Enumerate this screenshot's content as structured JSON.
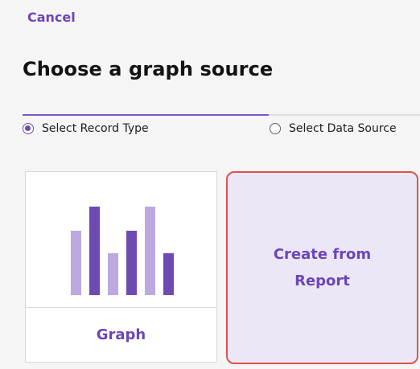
{
  "header": {
    "cancel_label": "Cancel",
    "title": "Choose a graph source"
  },
  "steps": [
    {
      "label": "Select Record Type",
      "selected": true
    },
    {
      "label": "Select Data Source",
      "selected": false
    }
  ],
  "cards": {
    "graph": {
      "label": "Graph",
      "icon": "bar-chart-icon",
      "icon_bars": [
        {
          "value": 80,
          "shade": "light"
        },
        {
          "value": 110,
          "shade": "dark"
        },
        {
          "value": 52,
          "shade": "light"
        },
        {
          "value": 80,
          "shade": "dark"
        },
        {
          "value": 110,
          "shade": "light"
        },
        {
          "value": 52,
          "shade": "dark"
        }
      ]
    },
    "report": {
      "label_line_1": "Create from",
      "label_line_2": "Report",
      "highlighted": true
    }
  },
  "colors": {
    "accent": "#6b46b8",
    "bar_dark": "#6d4bb2",
    "bar_light": "#bda8df",
    "highlight_border": "#e0524c",
    "report_card_bg": "#ece7f6"
  }
}
